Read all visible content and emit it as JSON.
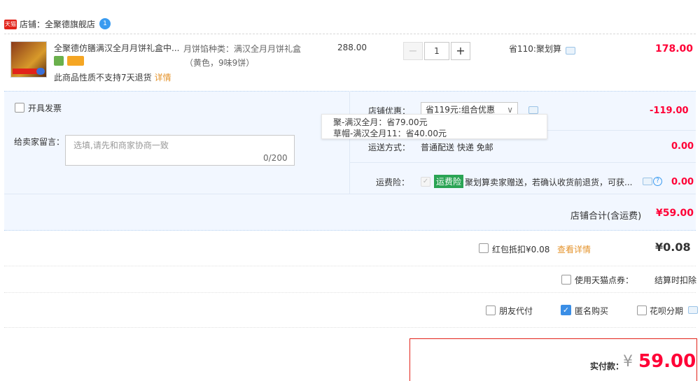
{
  "shop": {
    "badge": "天猫",
    "label": "店铺：全聚德旗舰店",
    "ww": "1"
  },
  "product": {
    "name": "全聚德仿膳满汉全月月饼礼盒中...",
    "no_return": "此商品性质不支持7天退货",
    "detail_link": "详情",
    "sku_line1": "月饼馅种类：满汉全月月饼礼盒",
    "sku_line2": "（黄色，9味9饼）",
    "price": "288.00",
    "qty_minus": "−",
    "qty": "1",
    "qty_plus": "+",
    "saving": "省110:聚划算",
    "subtotal": "178.00"
  },
  "invoice": {
    "label": "开具发票"
  },
  "message": {
    "label": "给卖家留言：",
    "placeholder": "选填,请先和商家协商一致",
    "count": "0/200"
  },
  "shop_discount": {
    "label": "店铺优惠：",
    "selected": "省119元:组合优惠",
    "chevron": "∨",
    "amount": "-119.00"
  },
  "tooltip": {
    "line1": "聚-满汉全月：省79.00元",
    "line2": "草帽-满汉全月11：省40.00元"
  },
  "shipping": {
    "label": "运送方式：",
    "value": "普通配送 快递 免邮",
    "amount": "0.00"
  },
  "insurance": {
    "label": "运费险：",
    "check": "✓",
    "tag": "运费险",
    "text": "聚划算卖家赠送，若确认收货前退货，可获...",
    "help": "?",
    "amount": "0.00"
  },
  "shop_total": {
    "label": "店铺合计(含运费)",
    "value": "¥59.00"
  },
  "red_packet": {
    "label": "红包抵扣¥0.08",
    "link": "查看详情",
    "value": "¥0.08"
  },
  "tmall_points": {
    "label": "使用天猫点券：",
    "value": "结算时扣除"
  },
  "options": {
    "friend_pay": "朋友代付",
    "anonymous_check": "✓",
    "anonymous": "匿名购买",
    "huabei": "花呗分期"
  },
  "payment": {
    "label": "实付款：",
    "currency": "¥",
    "amount": "59.00"
  },
  "colors": {
    "accent_red": "#ff0036",
    "tmall_red": "#e2231a",
    "link_orange": "#e4932b",
    "checkbox_blue": "#3a8ee6",
    "insurance_green": "#2aa454"
  }
}
